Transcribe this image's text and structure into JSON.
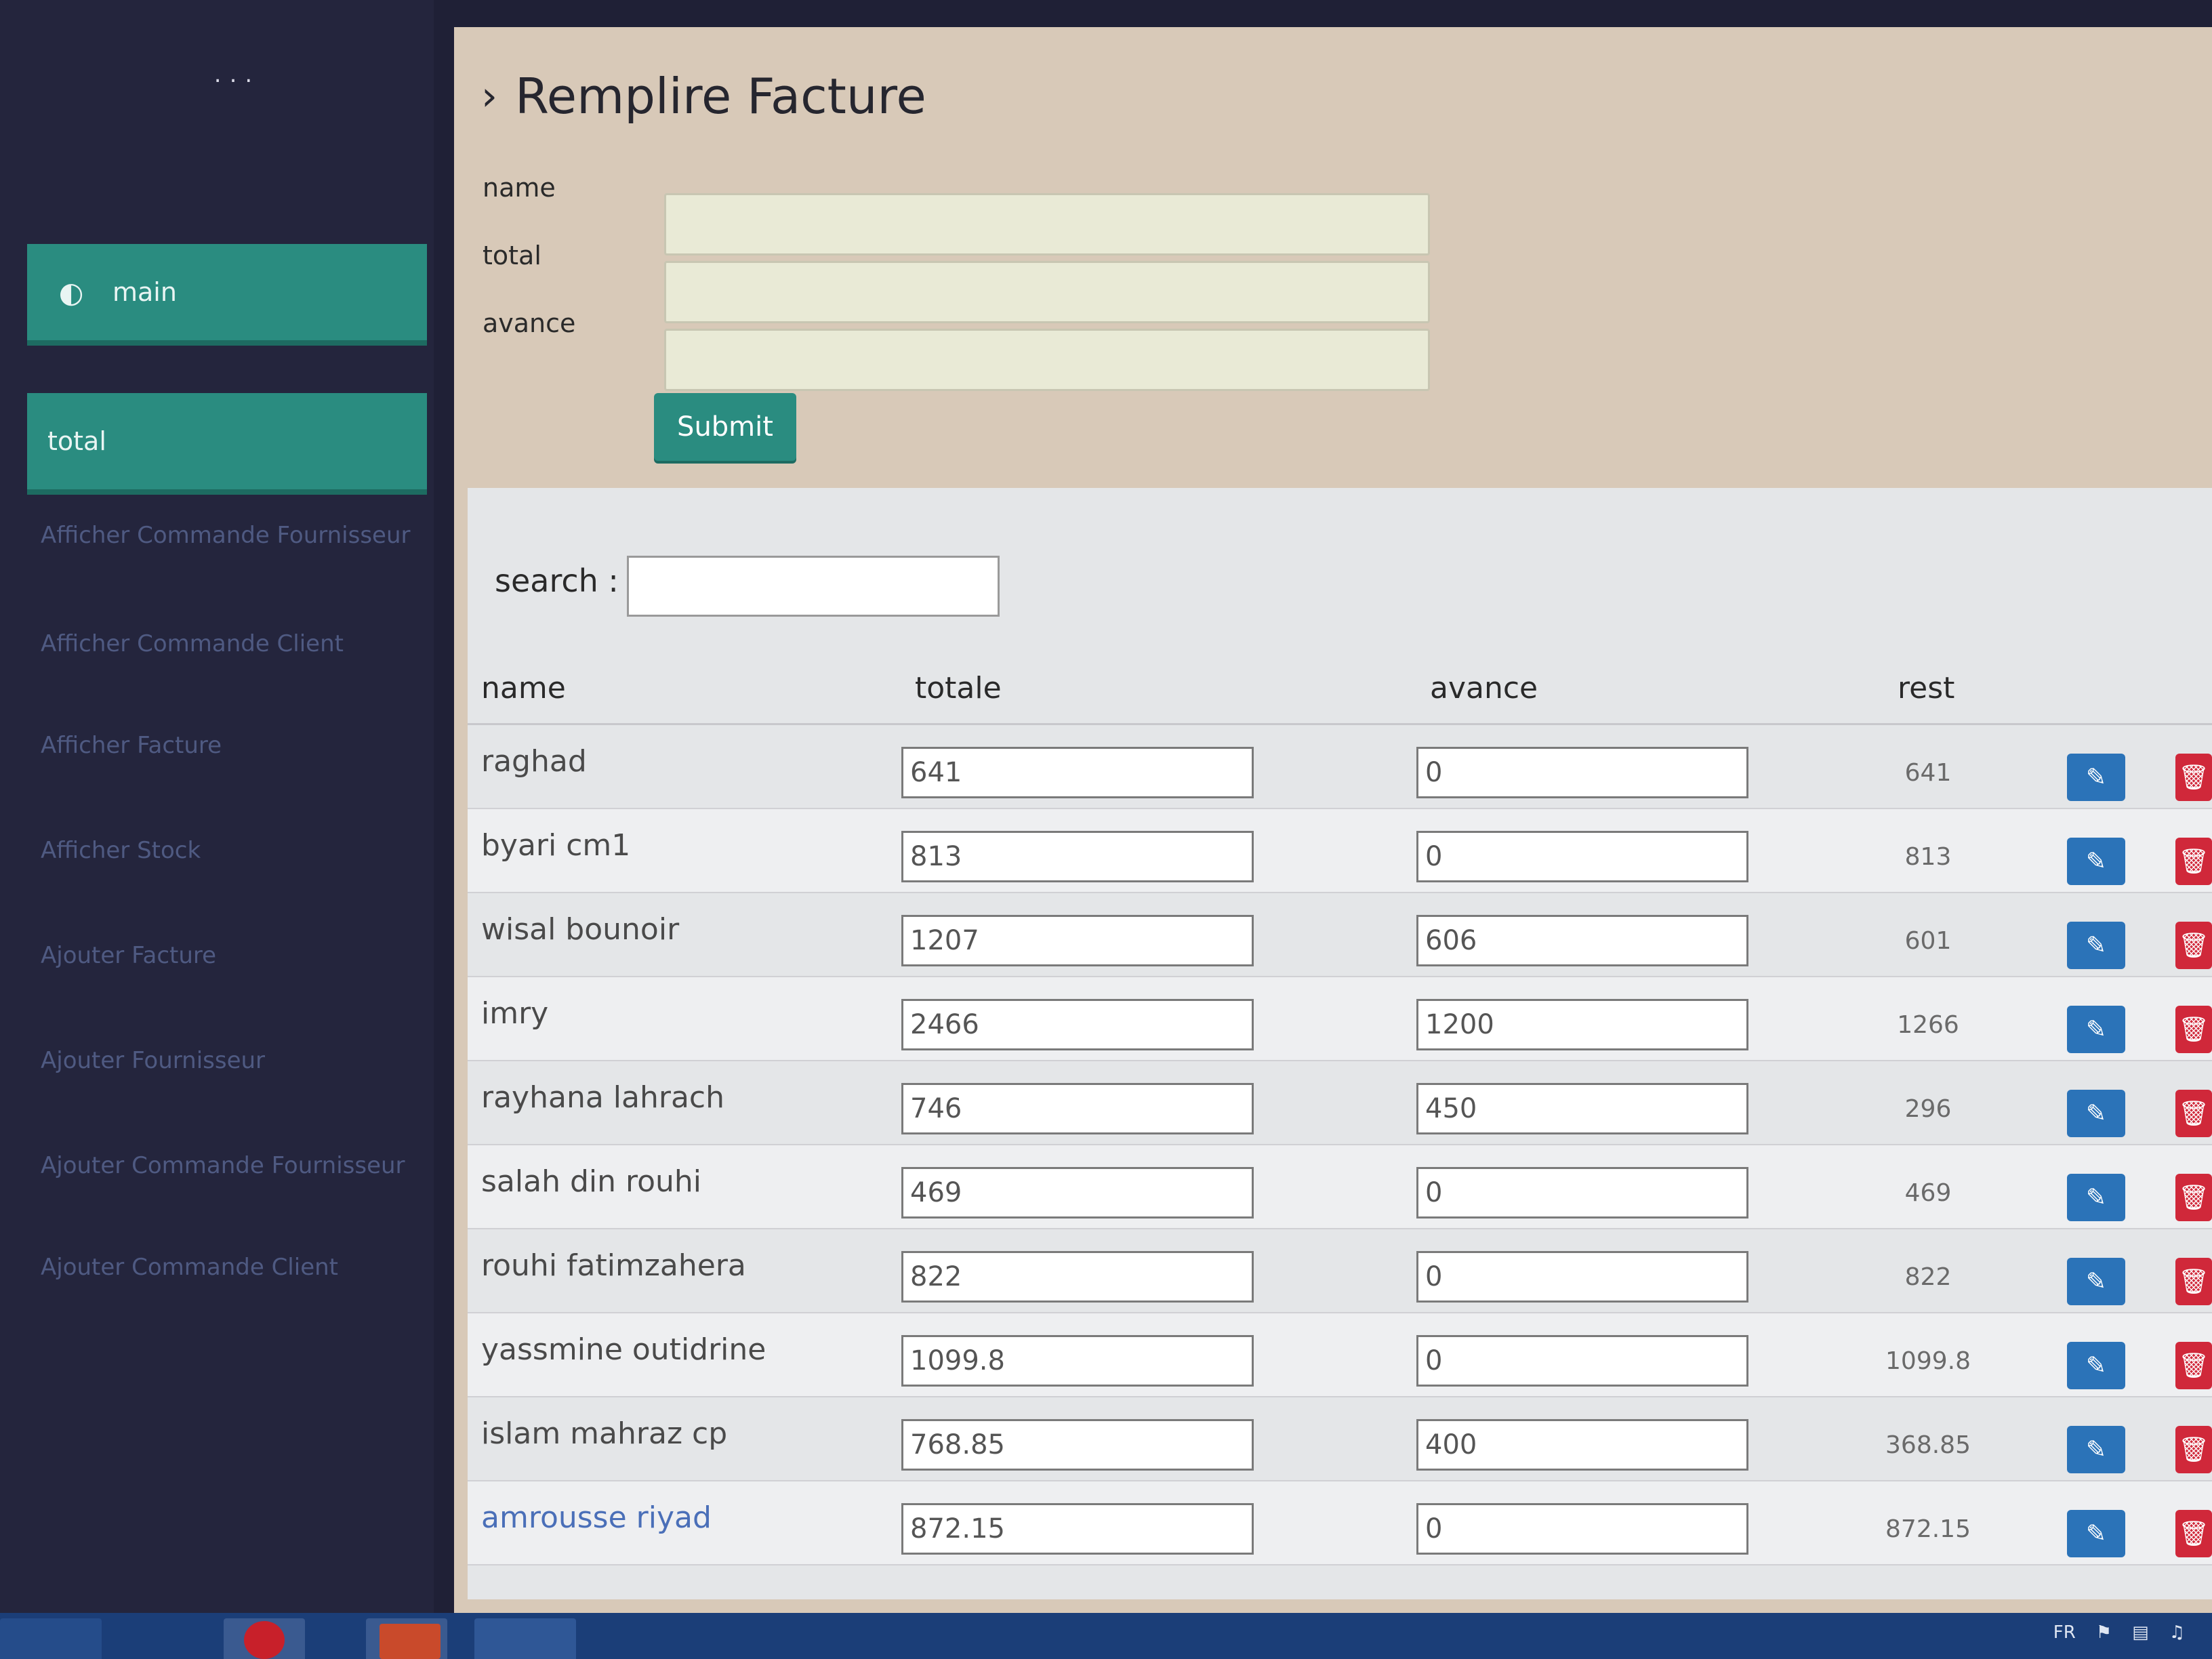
{
  "sidebar": {
    "logo_text": "...",
    "main_btn_label": "main",
    "total_btn_label": "total",
    "links": [
      "Afficher Commande Fournisseur",
      "Afficher Commande Client",
      "Afficher Facture",
      "Afficher Stock",
      "Ajouter Facture",
      "Ajouter Fournisseur",
      "Ajouter Commande Fournisseur",
      "Ajouter Commande Client"
    ]
  },
  "page": {
    "title": "Remplire Facture"
  },
  "form": {
    "name_label": "name",
    "total_label": "total",
    "avance_label": "avance",
    "name_value": "",
    "total_value": "",
    "avance_value": "",
    "submit_label": "Submit"
  },
  "table": {
    "search_label": "search :",
    "search_value": "",
    "headers": {
      "name": "name",
      "totale": "totale",
      "avance": "avance",
      "rest": "rest"
    },
    "rows": [
      {
        "name": "raghad",
        "totale": "641",
        "avance": "0",
        "rest": "641"
      },
      {
        "name": "byari cm1",
        "totale": "813",
        "avance": "0",
        "rest": "813"
      },
      {
        "name": "wisal bounoir",
        "totale": "1207",
        "avance": "606",
        "rest": "601"
      },
      {
        "name": "imry",
        "totale": "2466",
        "avance": "1200",
        "rest": "1266"
      },
      {
        "name": "rayhana lahrach",
        "totale": "746",
        "avance": "450",
        "rest": "296"
      },
      {
        "name": "salah din rouhi",
        "totale": "469",
        "avance": "0",
        "rest": "469"
      },
      {
        "name": "rouhi fatimzahera",
        "totale": "822",
        "avance": "0",
        "rest": "822"
      },
      {
        "name": "yassmine outidrine",
        "totale": "1099.8",
        "avance": "0",
        "rest": "1099.8"
      },
      {
        "name": "islam mahraz cp",
        "totale": "768.85",
        "avance": "400",
        "rest": "368.85"
      },
      {
        "name": "amrousse riyad",
        "totale": "872.15",
        "avance": "0",
        "rest": "872.15"
      }
    ]
  },
  "taskbar": {
    "lang": "FR"
  },
  "colors": {
    "accent": "#2a8c80",
    "sidebar_bg": "#24253d",
    "edit": "#2b73b8",
    "delete": "#d0283a"
  },
  "icons": {
    "main": "dashboard-icon",
    "edit": "pencil-icon",
    "delete": "trash-icon",
    "title": "chevron-right-icon"
  }
}
